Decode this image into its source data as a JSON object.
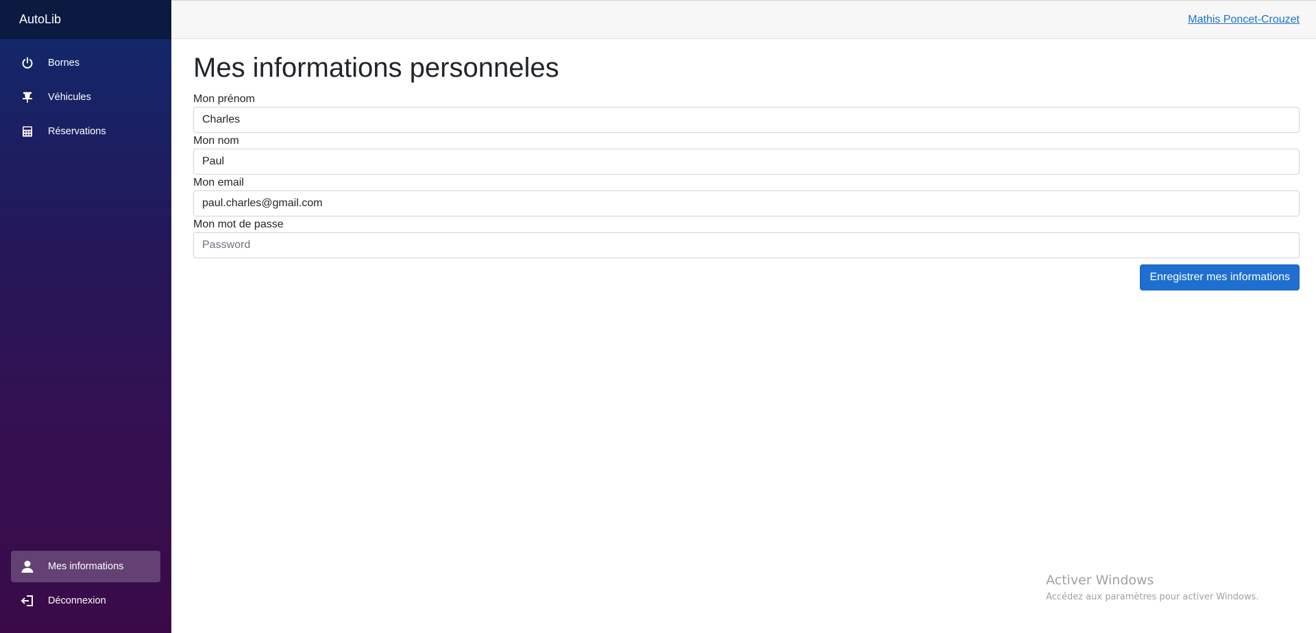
{
  "app": {
    "brand": "AutoLib"
  },
  "sidebar": {
    "items": [
      {
        "label": "Bornes",
        "icon": "power-icon"
      },
      {
        "label": "Véhicules",
        "icon": "pin-icon"
      },
      {
        "label": "Réservations",
        "icon": "calculator-icon"
      }
    ],
    "bottom_items": [
      {
        "label": "Mes informations",
        "icon": "user-icon",
        "active": true
      },
      {
        "label": "Déconnexion",
        "icon": "logout-icon"
      }
    ]
  },
  "header": {
    "user_name": "Mathis Poncet-Crouzet"
  },
  "main": {
    "title": "Mes informations personneles",
    "fields": [
      {
        "label": "Mon prénom",
        "value": "Charles",
        "placeholder": ""
      },
      {
        "label": "Mon nom",
        "value": "Paul",
        "placeholder": ""
      },
      {
        "label": "Mon email",
        "value": "paul.charles@gmail.com",
        "placeholder": ""
      },
      {
        "label": "Mon mot de passe",
        "value": "",
        "placeholder": "Password"
      }
    ],
    "save_label": "Enregistrer mes informations"
  },
  "watermark": {
    "title": "Activer Windows",
    "subtitle": "Accédez aux paramètres pour activer Windows."
  },
  "colors": {
    "primary": "#1e6fcf",
    "link": "#1a73c8",
    "sidebar_top": "#0f2a6e",
    "sidebar_bottom": "#3a0a48"
  }
}
